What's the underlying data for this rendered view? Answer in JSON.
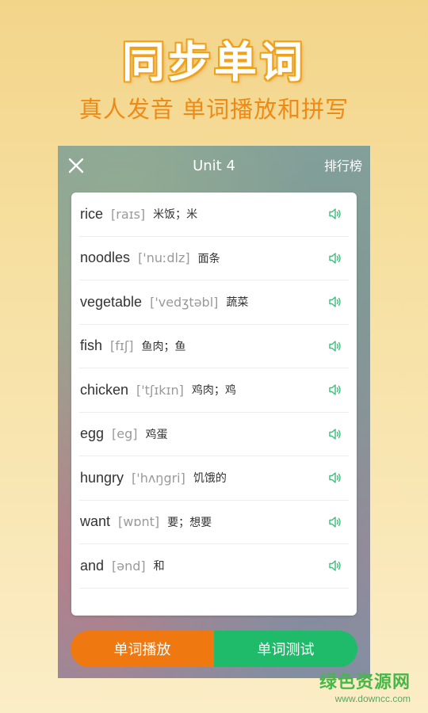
{
  "hero": {
    "title": "同步单词",
    "subtitle": "真人发音 单词播放和拼写"
  },
  "header": {
    "title": "Unit 4",
    "rank_label": "排行榜",
    "close_icon": "close-icon"
  },
  "words": [
    {
      "word": "rice",
      "phonetic": "[raɪs]",
      "meaning": "米饭；米"
    },
    {
      "word": "noodles",
      "phonetic": "['nuːdlz]",
      "meaning": "面条"
    },
    {
      "word": "vegetable",
      "phonetic": "['vedʒtəbl]",
      "meaning": "蔬菜"
    },
    {
      "word": "fish",
      "phonetic": "[fɪʃ]",
      "meaning": "鱼肉；鱼"
    },
    {
      "word": "chicken",
      "phonetic": "['tʃɪkɪn]",
      "meaning": "鸡肉；鸡"
    },
    {
      "word": "egg",
      "phonetic": "[eg]",
      "meaning": "鸡蛋"
    },
    {
      "word": "hungry",
      "phonetic": "['hʌŋgri]",
      "meaning": "饥饿的"
    },
    {
      "word": "want",
      "phonetic": "[wɒnt]",
      "meaning": "要；想要"
    },
    {
      "word": "and",
      "phonetic": "[ənd]",
      "meaning": "和"
    }
  ],
  "actions": {
    "play_label": "单词播放",
    "test_label": "单词测试"
  },
  "watermark": {
    "title": "绿色资源网",
    "url": "www.downcc.com"
  },
  "colors": {
    "accent_orange": "#f07810",
    "accent_green": "#1fbb6a",
    "speaker_green": "#3bbf7a"
  }
}
